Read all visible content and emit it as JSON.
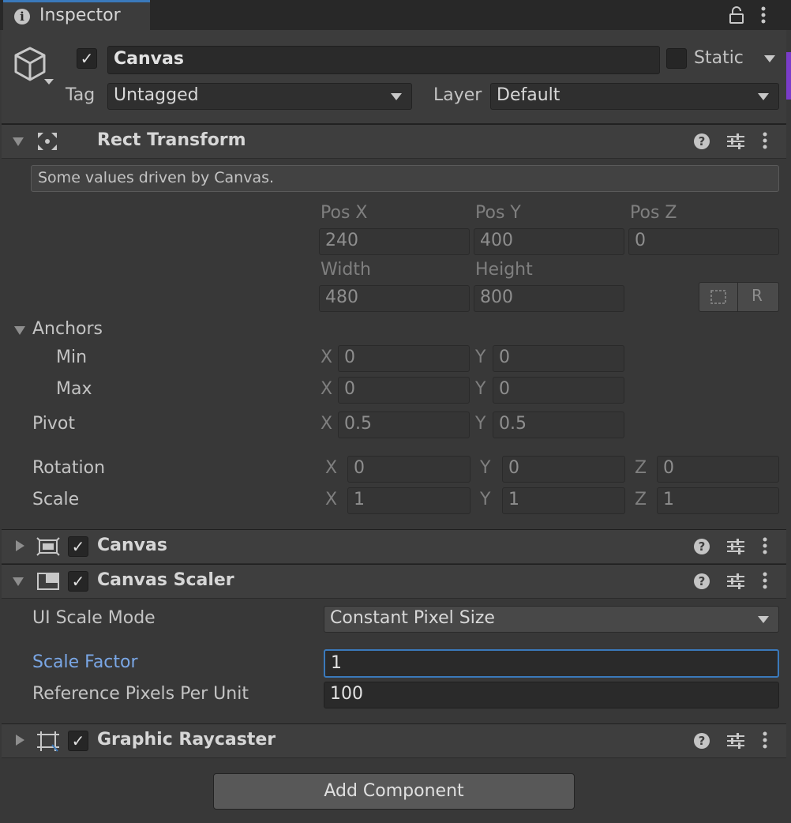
{
  "window": {
    "tab_title": "Inspector"
  },
  "gameobject": {
    "name": "Canvas",
    "static_label": "Static",
    "tag_label": "Tag",
    "tag_value": "Untagged",
    "layer_label": "Layer",
    "layer_value": "Default"
  },
  "rect_transform": {
    "title": "Rect Transform",
    "notice": "Some values driven by Canvas.",
    "pos_x_label": "Pos X",
    "pos_y_label": "Pos Y",
    "pos_z_label": "Pos Z",
    "pos_x": "240",
    "pos_y": "400",
    "pos_z": "0",
    "width_label": "Width",
    "height_label": "Height",
    "width": "480",
    "height": "800",
    "r_button": "R",
    "anchors_label": "Anchors",
    "min_label": "Min",
    "max_label": "Max",
    "pivot_label": "Pivot",
    "rotation_label": "Rotation",
    "scale_label": "Scale",
    "axis_x": "X",
    "axis_y": "Y",
    "axis_z": "Z",
    "anchor_min_x": "0",
    "anchor_min_y": "0",
    "anchor_max_x": "0",
    "anchor_max_y": "0",
    "pivot_x": "0.5",
    "pivot_y": "0.5",
    "rotation_x": "0",
    "rotation_y": "0",
    "rotation_z": "0",
    "scale_x": "1",
    "scale_y": "1",
    "scale_z": "1"
  },
  "canvas_component": {
    "title": "Canvas"
  },
  "canvas_scaler": {
    "title": "Canvas Scaler",
    "ui_scale_mode_label": "UI Scale Mode",
    "ui_scale_mode_value": "Constant Pixel Size",
    "scale_factor_label": "Scale Factor",
    "scale_factor_value": "1",
    "ref_ppu_label": "Reference Pixels Per Unit",
    "ref_ppu_value": "100"
  },
  "graphic_raycaster": {
    "title": "Graphic Raycaster"
  },
  "add_component_label": "Add Component",
  "colors": {
    "accent": "#3a79bb",
    "active_label": "#7aa7e6",
    "check": "#e0e0e0"
  }
}
